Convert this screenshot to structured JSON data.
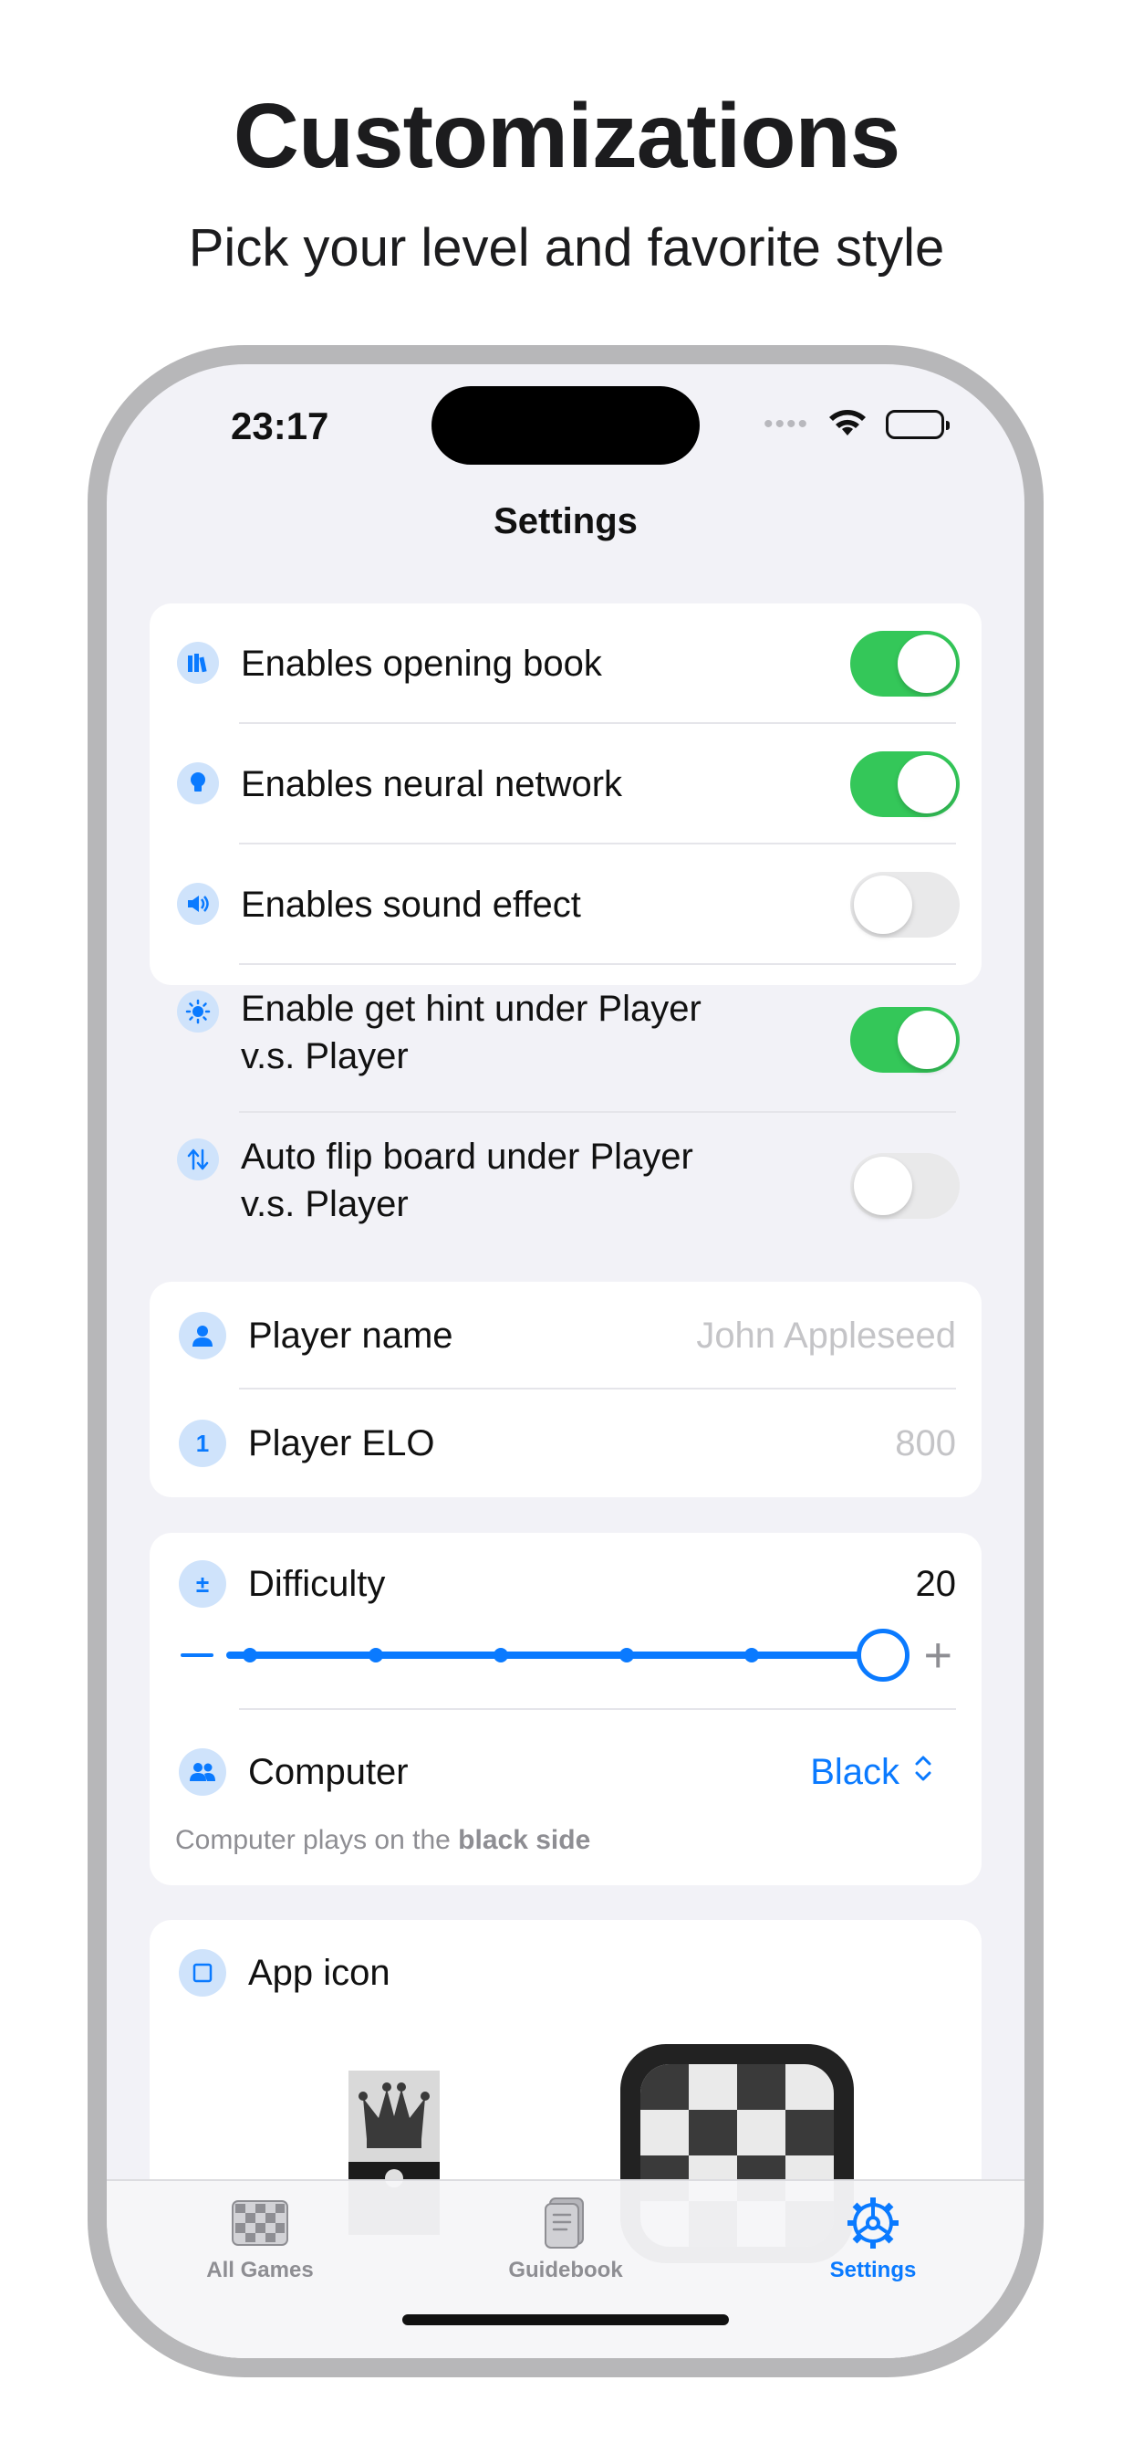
{
  "hero": {
    "title": "Customizations",
    "subtitle": "Pick your level and favorite style"
  },
  "status_bar": {
    "time": "23:17",
    "dots": "••••",
    "icons": [
      "wifi-icon",
      "battery-icon"
    ]
  },
  "nav": {
    "title": "Settings"
  },
  "toggles": [
    {
      "icon": "books-icon",
      "label": "Enables opening book",
      "on": true
    },
    {
      "icon": "lightbulb-icon",
      "label": "Enables neural network",
      "on": true
    },
    {
      "icon": "speaker-icon",
      "label": "Enables sound effect",
      "on": false
    },
    {
      "icon": "sun-icon",
      "label_line1": "Enable get hint under Player",
      "label_line2": "v.s. Player",
      "on": true
    },
    {
      "icon": "flip-arrows-icon",
      "label_line1": "Auto flip board under Player",
      "label_line2": "v.s. Player",
      "on": false
    }
  ],
  "player": {
    "name_label": "Player name",
    "name_placeholder": "John Appleseed",
    "elo_label": "Player ELO",
    "elo_icon_text": "1",
    "elo_placeholder": "800"
  },
  "difficulty": {
    "icon_text": "±",
    "label": "Difficulty",
    "value": "20",
    "slider_fraction": 1.0,
    "computer_label": "Computer",
    "computer_value": "Black",
    "footnote_prefix": "Computer plays on the ",
    "footnote_bold": "black side"
  },
  "app_icon": {
    "label": "App icon"
  },
  "tabs": [
    {
      "label": "All Games",
      "icon": "checkerboard-icon",
      "active": false
    },
    {
      "label": "Guidebook",
      "icon": "book-icon",
      "active": false
    },
    {
      "label": "Settings",
      "icon": "gear-icon",
      "active": true
    }
  ],
  "colors": {
    "accent": "#0A7AFF",
    "toggle_on": "#34C759",
    "toggle_off": "#E9E9EA",
    "background": "#F2F2F7"
  }
}
